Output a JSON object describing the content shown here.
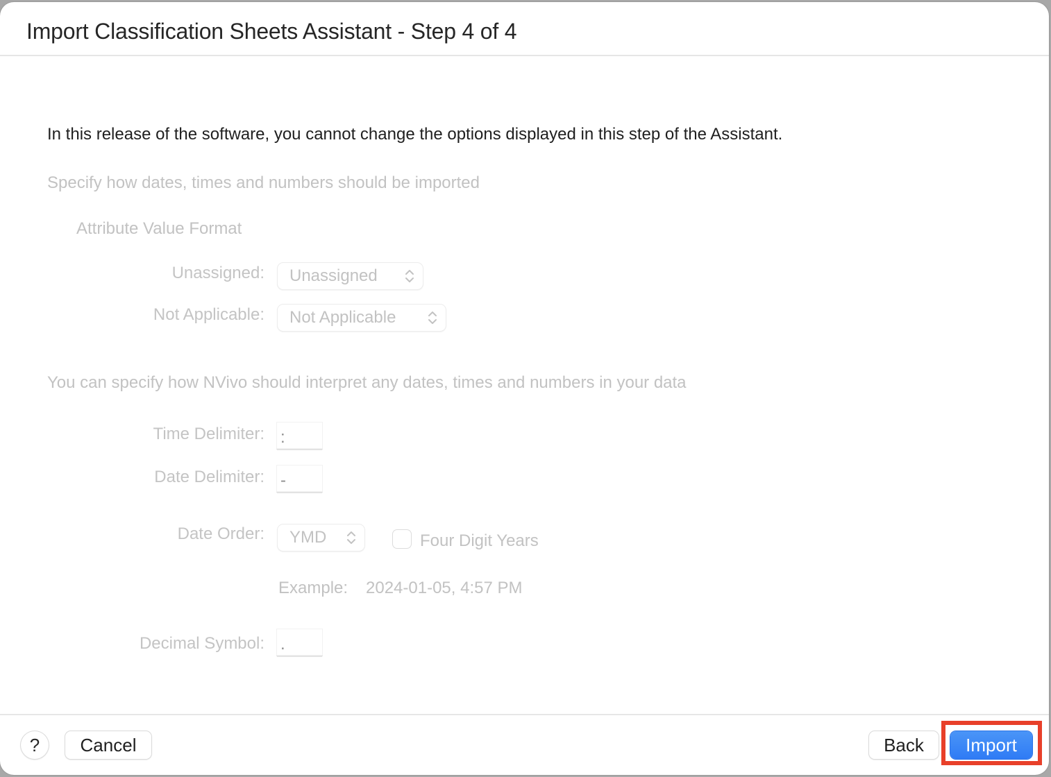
{
  "window": {
    "title": "Import Classification Sheets Assistant - Step 4 of 4"
  },
  "intro": "In this release of the software, you cannot change the options displayed in this step of the Assistant.",
  "attribute_section": {
    "heading": "Specify how dates, times and numbers should be imported",
    "subheading": "Attribute Value Format",
    "unassigned": {
      "label": "Unassigned:",
      "value": "Unassigned"
    },
    "not_applicable": {
      "label": "Not Applicable:",
      "value": "Not Applicable"
    }
  },
  "interpret_section": {
    "heading": "You can specify how NVivo should interpret any dates, times and numbers in your data",
    "time_delimiter": {
      "label": "Time Delimiter:",
      "value": ":"
    },
    "date_delimiter": {
      "label": "Date Delimiter:",
      "value": "-"
    },
    "date_order": {
      "label": "Date Order:",
      "value": "YMD"
    },
    "four_digit_years": {
      "label": "Four Digit Years",
      "checked": false
    },
    "example": {
      "label": "Example:",
      "value": "2024-01-05, 4:57 PM"
    },
    "decimal_symbol": {
      "label": "Decimal Symbol:",
      "value": "."
    }
  },
  "footer": {
    "help_label": "?",
    "cancel_label": "Cancel",
    "back_label": "Back",
    "import_label": "Import"
  },
  "colors": {
    "accent": "#3683f6",
    "highlight": "#e8402a"
  }
}
